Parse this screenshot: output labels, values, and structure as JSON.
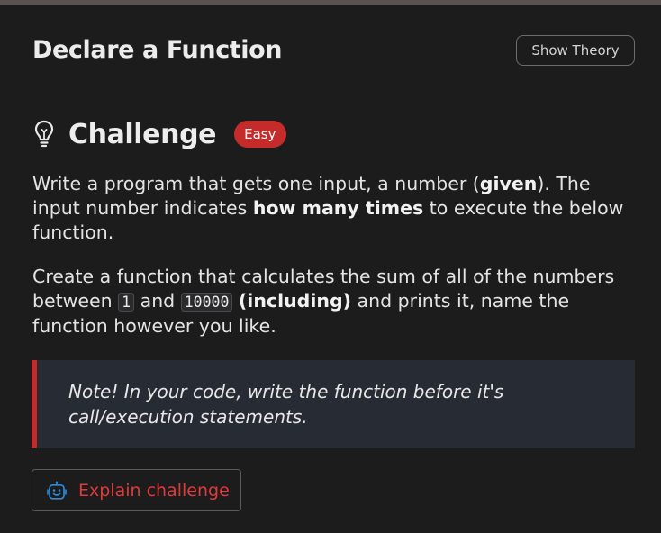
{
  "header": {
    "title": "Declare a Function",
    "show_theory_label": "Show Theory"
  },
  "challenge": {
    "icon": "lightbulb-icon",
    "title": "Challenge",
    "difficulty": "Easy",
    "difficulty_color": "#c62b2b",
    "paragraph1": {
      "t1": "Write a program that gets one input, a number (",
      "b1": "given",
      "t2": "). The input number indicates ",
      "b2": "how many times",
      "t3": " to execute the below function."
    },
    "paragraph2": {
      "t1": "Create a function that calculates the sum of all of the numbers between ",
      "code1": "1",
      "t2": " and ",
      "code2": "10000",
      "t3": " ",
      "b1": "(including)",
      "t4": " and prints it, name the function however you like."
    },
    "note": "Note! In your code, write the function before it's call/execution statements."
  },
  "explain": {
    "icon": "robot-icon",
    "label": "Explain challenge",
    "label_color": "#e03a3a"
  }
}
